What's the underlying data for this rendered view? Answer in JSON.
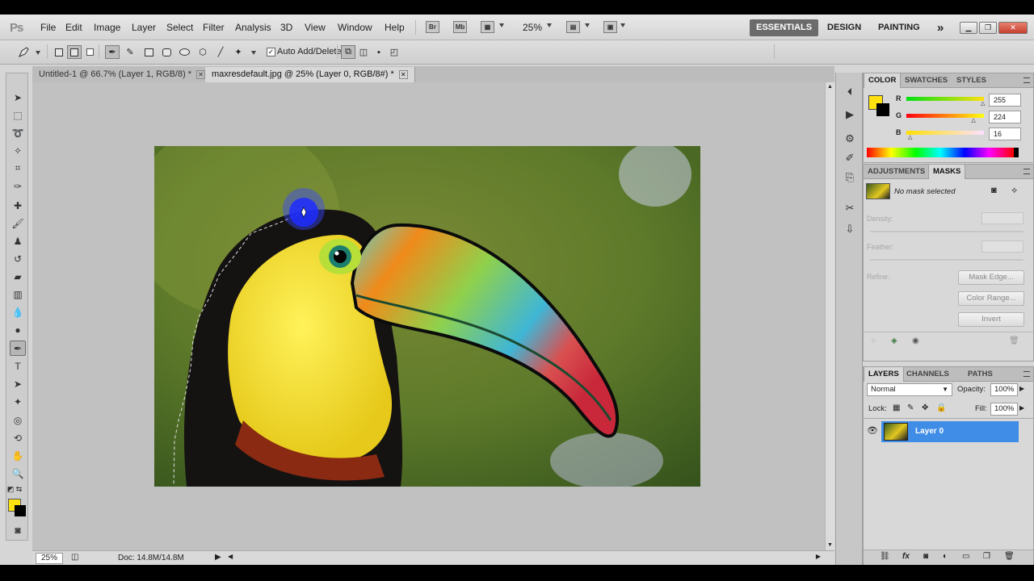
{
  "app": {
    "logo": "Ps"
  },
  "menu": [
    "File",
    "Edit",
    "Image",
    "Layer",
    "Select",
    "Filter",
    "Analysis",
    "3D",
    "View",
    "Window",
    "Help"
  ],
  "toolbar": {
    "bridge": "Br",
    "minibridge": "Mb",
    "zoom": "25%"
  },
  "workspaces": {
    "essentials": "ESSENTIALS",
    "design": "DESIGN",
    "painting": "PAINTING",
    "more": "»"
  },
  "options": {
    "auto_add_delete": "Auto Add/Delete",
    "checked": "✓"
  },
  "tabs": [
    {
      "label": "Untitled-1 @ 66.7% (Layer 1, RGB/8) *"
    },
    {
      "label": "maxresdefault.jpg @ 25% (Layer 0, RGB/8#) *"
    }
  ],
  "status": {
    "zoom": "25%",
    "doc": "Doc: 14.8M/14.8M"
  },
  "color_panel": {
    "tabs": [
      "COLOR",
      "SWATCHES",
      "STYLES"
    ],
    "r_label": "R",
    "g_label": "G",
    "b_label": "B",
    "r": "255",
    "g": "224",
    "b": "16",
    "r_level": 255,
    "g_level": 224,
    "b_level": 16,
    "foreground": "#ffe010",
    "background": "#000000"
  },
  "masks_panel": {
    "tabs": [
      "ADJUSTMENTS",
      "MASKS"
    ],
    "status": "No mask selected",
    "density": "Density:",
    "feather": "Feather:",
    "refine": "Refine:",
    "buttons": [
      "Mask Edge...",
      "Color Range...",
      "Invert"
    ]
  },
  "layers_panel": {
    "tabs": [
      "LAYERS",
      "CHANNELS",
      "PATHS"
    ],
    "blend_mode": "Normal",
    "opacity_label": "Opacity:",
    "opacity": "100%",
    "lock_label": "Lock:",
    "fill_label": "Fill:",
    "fill": "100%",
    "layer_name": "Layer 0"
  }
}
